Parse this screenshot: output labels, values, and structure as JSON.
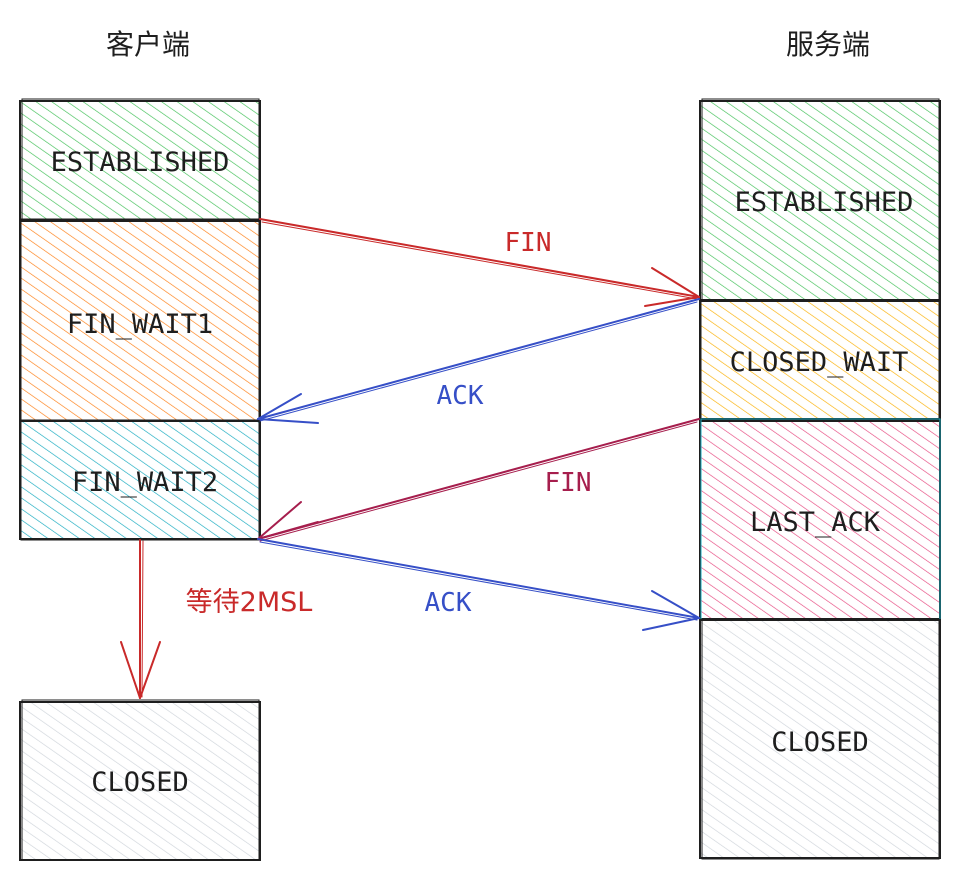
{
  "headers": {
    "client": "客户端",
    "server": "服务端"
  },
  "client_states": [
    {
      "label": "ESTABLISHED",
      "color": "#40c057"
    },
    {
      "label": "FIN_WAIT1",
      "color": "#fd7e14"
    },
    {
      "label": "FIN_WAIT2",
      "color": "#15aabf"
    },
    {
      "label": "CLOSED",
      "color": "#adb5bd"
    }
  ],
  "server_states": [
    {
      "label": "ESTABLISHED",
      "color": "#40c057"
    },
    {
      "label": "CLOSED_WAIT",
      "color": "#fab005"
    },
    {
      "label": "LAST_ACK",
      "color": "#e64980"
    },
    {
      "label": "CLOSED",
      "color": "#adb5bd"
    }
  ],
  "messages": [
    {
      "label": "FIN",
      "color": "#c92a2a"
    },
    {
      "label": "ACK",
      "color": "#364fc7"
    },
    {
      "label": "FIN",
      "color": "#a61e4d"
    },
    {
      "label": "ACK",
      "color": "#364fc7"
    }
  ],
  "wait": {
    "label": "等待2MSL",
    "color": "#c92a2a"
  }
}
